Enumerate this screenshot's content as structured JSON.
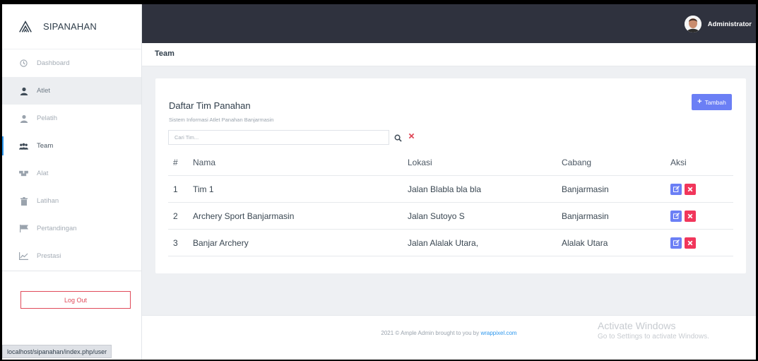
{
  "brand": {
    "name": "SIPANAHAN"
  },
  "sidebar": {
    "items": [
      {
        "label": "Dashboard",
        "icon": "clock-icon"
      },
      {
        "label": "Atlet",
        "icon": "user-icon"
      },
      {
        "label": "Pelatih",
        "icon": "user-icon"
      },
      {
        "label": "Team",
        "icon": "users-icon"
      },
      {
        "label": "Alat",
        "icon": "tools-icon"
      },
      {
        "label": "Latihan",
        "icon": "trash-icon"
      },
      {
        "label": "Pertandingan",
        "icon": "flag-icon"
      },
      {
        "label": "Prestasi",
        "icon": "chart-icon"
      }
    ],
    "logout_label": "Log Out"
  },
  "topbar": {
    "user_name": "Administrator"
  },
  "page": {
    "title": "Team"
  },
  "card": {
    "title": "Daftar Tim Panahan",
    "subtitle": "Sistem Informasi Atlet Panahan Banjarmasin",
    "add_label": "Tambah",
    "search_placeholder": "Cari Tim..."
  },
  "table": {
    "headers": {
      "no": "#",
      "nama": "Nama",
      "lokasi": "Lokasi",
      "cabang": "Cabang",
      "aksi": "Aksi"
    },
    "rows": [
      {
        "no": "1",
        "nama": "Tim 1",
        "lokasi": "Jalan Blabla bla bla",
        "cabang": "Banjarmasin"
      },
      {
        "no": "2",
        "nama": "Archery Sport Banjarmasin",
        "lokasi": "Jalan Sutoyo S",
        "cabang": "Banjarmasin"
      },
      {
        "no": "3",
        "nama": "Banjar Archery",
        "lokasi": "Jalan Alalak Utara,",
        "cabang": "Alalak Utara"
      }
    ]
  },
  "footer": {
    "text": "2021 © Ample Admin brought to you by ",
    "link": "wrappixel.com"
  },
  "watermark": {
    "title": "Activate Windows",
    "subtitle": "Go to Settings to activate Windows."
  },
  "statusbar": {
    "url": "localhost/sipanahan/index.php/user"
  },
  "colors": {
    "primary": "#6b7ff5",
    "danger": "#f1365b",
    "topbar": "#2f323e",
    "accent": "#2b96ed"
  }
}
